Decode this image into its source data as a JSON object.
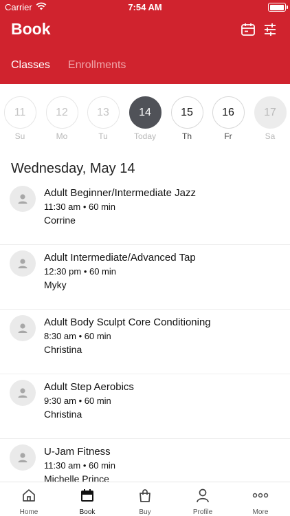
{
  "status_bar": {
    "carrier": "Carrier",
    "time": "7:54 AM"
  },
  "header": {
    "title": "Book",
    "icons": [
      "calendar-icon",
      "filter-sliders-icon"
    ]
  },
  "tabs": [
    {
      "label": "Classes",
      "active": true
    },
    {
      "label": "Enrollments",
      "active": false
    }
  ],
  "days": [
    {
      "num": "11",
      "label": "Su",
      "state": "past"
    },
    {
      "num": "12",
      "label": "Mo",
      "state": "past"
    },
    {
      "num": "13",
      "label": "Tu",
      "state": "past"
    },
    {
      "num": "14",
      "label": "Today",
      "state": "selected"
    },
    {
      "num": "15",
      "label": "Th",
      "state": "future"
    },
    {
      "num": "16",
      "label": "Fr",
      "state": "future"
    },
    {
      "num": "17",
      "label": "Sa",
      "state": "disabled"
    }
  ],
  "date_heading": "Wednesday, May 14",
  "classes": [
    {
      "name": "Adult Beginner/Intermediate Jazz",
      "meta": "11:30 am • 60 min",
      "instructor": "Corrine"
    },
    {
      "name": "Adult Intermediate/Advanced Tap",
      "meta": "12:30 pm • 60 min",
      "instructor": "Myky"
    },
    {
      "name": "Adult Body Sculpt Core Conditioning",
      "meta": "8:30 am • 60 min",
      "instructor": "Christina"
    },
    {
      "name": "Adult Step Aerobics",
      "meta": "9:30 am • 60 min",
      "instructor": "Christina"
    },
    {
      "name": "U-Jam Fitness",
      "meta": "11:30 am • 60 min",
      "instructor": "Michelle Prince"
    }
  ],
  "tab_bar": [
    {
      "label": "Home",
      "icon": "home-icon",
      "active": false
    },
    {
      "label": "Book",
      "icon": "calendar-icon",
      "active": true
    },
    {
      "label": "Buy",
      "icon": "shopping-bag-icon",
      "active": false
    },
    {
      "label": "Profile",
      "icon": "person-icon",
      "active": false
    },
    {
      "label": "More",
      "icon": "more-dots-icon",
      "active": false
    }
  ],
  "colors": {
    "brand": "#d0232e",
    "selected_day": "#505258"
  }
}
